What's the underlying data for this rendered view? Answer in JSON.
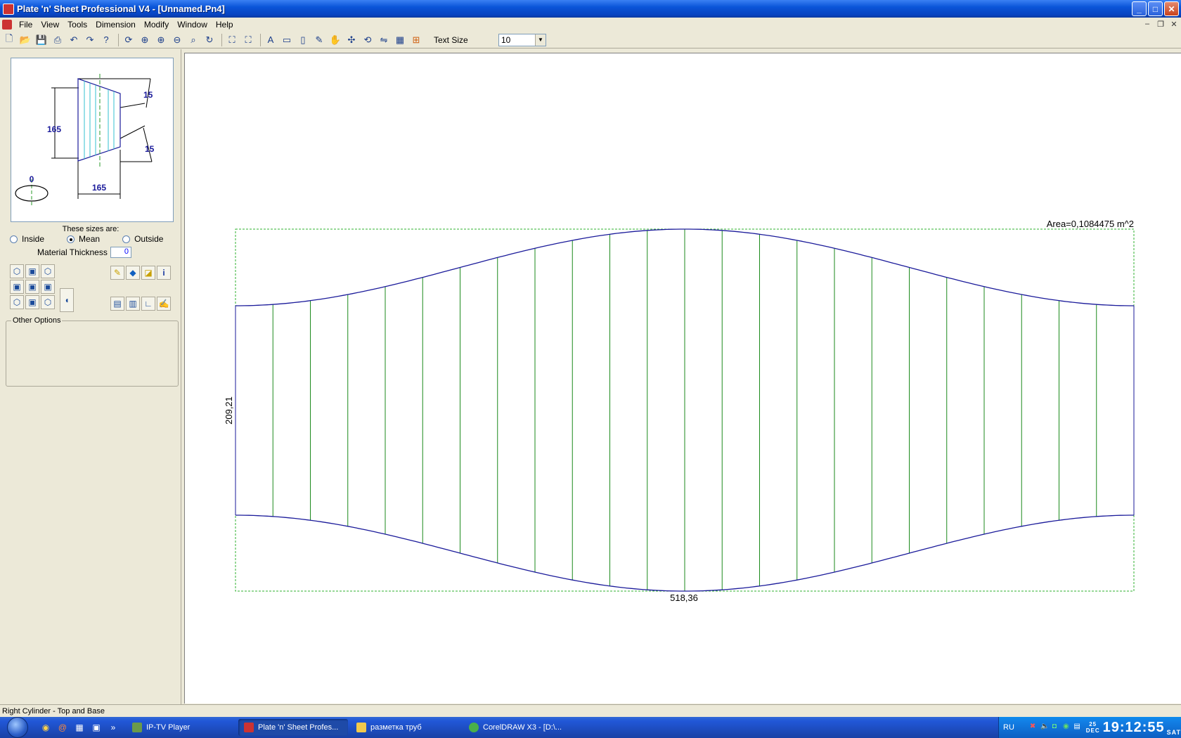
{
  "window": {
    "title": "Plate 'n' Sheet Professional V4 - [Unnamed.Pn4]"
  },
  "menu": [
    "File",
    "View",
    "Tools",
    "Dimension",
    "Modify",
    "Window",
    "Help"
  ],
  "toolbar": {
    "text_size_label": "Text Size",
    "text_size_value": "10"
  },
  "left_panel": {
    "diagram": {
      "dim_top": "15",
      "dim_bottom": "15",
      "dim_height": "165",
      "dim_width": "165",
      "dim_angle": "0"
    },
    "sizes_title": "These sizes are:",
    "options": [
      {
        "label": "Inside",
        "selected": false
      },
      {
        "label": "Mean",
        "selected": true
      },
      {
        "label": "Outside",
        "selected": false
      }
    ],
    "material_thickness_label": "Material Thickness",
    "material_thickness_value": "0",
    "other_options_label": "Other Options"
  },
  "canvas": {
    "area_label": "Area=0,1084475 m^2",
    "height_label": "209,21",
    "width_label": "518,36",
    "colors": {
      "outline": "#1a1a9a",
      "lines": "#1b8a1b",
      "box": "#2fb02f"
    }
  },
  "status": {
    "text": "Right Cylinder - Top and Base"
  },
  "taskbar": {
    "tasks": [
      {
        "label": "IP-TV Player",
        "active": false
      },
      {
        "label": "Plate 'n' Sheet Profes...",
        "active": true
      },
      {
        "label": "разметка труб",
        "active": false
      },
      {
        "label": "CorelDRAW X3 - [D:\\...",
        "active": false
      }
    ],
    "lang": "RU",
    "clock": {
      "day_num": "25",
      "month": "DEC",
      "time": "19:12:55",
      "weekday": "SAT"
    }
  }
}
